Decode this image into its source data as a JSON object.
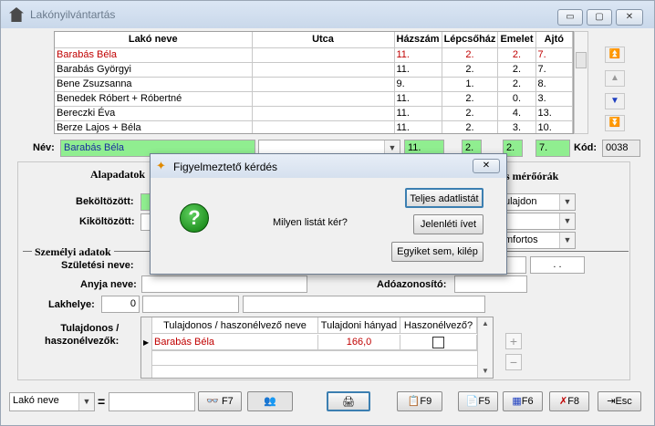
{
  "window": {
    "title": "Lakónyilvántartás",
    "minimize": "▭",
    "maximize": "▢",
    "close": "✕"
  },
  "grid": {
    "columns": [
      "Lakó neve",
      "Utca",
      "Házszám",
      "Lépcsőház",
      "Emelet",
      "Ajtó"
    ],
    "rows": [
      [
        "Barabás Béla",
        "",
        "11.",
        "2.",
        "2.",
        "7."
      ],
      [
        "Barabás Györgyi",
        "",
        "11.",
        "2.",
        "2.",
        "7."
      ],
      [
        "Bene Zsuzsanna",
        "",
        "9.",
        "1.",
        "2.",
        "8."
      ],
      [
        "Benedek Róbert + Róbertné",
        "",
        "11.",
        "2.",
        "0.",
        "3."
      ],
      [
        "Bereczki Éva",
        "",
        "11.",
        "2.",
        "4.",
        "13."
      ],
      [
        "Berze Lajos + Béla",
        "",
        "11.",
        "2.",
        "3.",
        "10."
      ]
    ]
  },
  "record": {
    "nev_label": "Név:",
    "nev_value": "Barabás Béla",
    "hazszam": "11.",
    "lepcsohaz": "2.",
    "emelet": "2.",
    "ajto": "7.",
    "kod_label": "Kód:",
    "kod_value": "0038"
  },
  "tabs": {
    "alapadatok": "Alapadatok",
    "meroorak": "s mérőórák"
  },
  "form": {
    "bekoltozott": "Beköltözött:",
    "kikoltozott": "Kiköltözött:",
    "szemelyi_adatok": "Személyi adatok",
    "szuletesi_neve": "Születési neve:",
    "anyja_neve": "Anyja neve:",
    "adoazonosito": "Adóazonosító:",
    "lakhelye": "Lakhelye:",
    "lakhelye_value": "0",
    "date_dots": ". .",
    "tulajdon_value": "ulajdon",
    "komfort_value": "mfortos",
    "tulaj_label": "Tulajdonos /\nhaszonélvezők:",
    "owners_columns": [
      "Tulajdonos / haszonélvező neve",
      "Tulajdoni hányad",
      "Haszonélvező?"
    ],
    "owners_rows": [
      {
        "name": "Barabás Béla",
        "share": "166,0"
      }
    ]
  },
  "dialog": {
    "title": "Figyelmeztető kérdés",
    "question": "Milyen listát kér?",
    "btn_full": "Teljes adatlistát",
    "btn_sheet": "Jelenléti ívet",
    "btn_none": "Egyiket sem, kilép"
  },
  "bottom": {
    "sort_value": "Lakó neve",
    "equals": "=",
    "f7": "F7",
    "f9": "F9",
    "f5": "F5",
    "f6": "F6",
    "f8": "F8",
    "esc": "Esc"
  }
}
